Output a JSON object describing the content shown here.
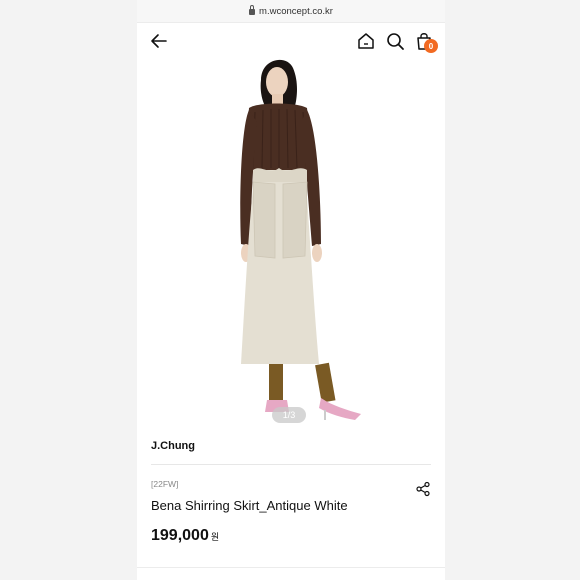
{
  "browser": {
    "url": "m.wconcept.co.kr"
  },
  "header": {
    "cart_count": "0"
  },
  "gallery": {
    "pager": "1/3"
  },
  "product": {
    "brand": "J.Chung",
    "season": "[22FW]",
    "name": "Bena Shirring Skirt_Antique White",
    "price": "199,000",
    "currency": "원"
  },
  "colors": {
    "accent": "#f26a22",
    "sweater": "#4a2e22",
    "skirt": "#e4dfd2",
    "shoes": "#e6a8c4"
  },
  "icons": [
    "back-arrow-icon",
    "home-icon",
    "search-icon",
    "shopping-bag-icon",
    "share-icon",
    "lock-icon"
  ]
}
